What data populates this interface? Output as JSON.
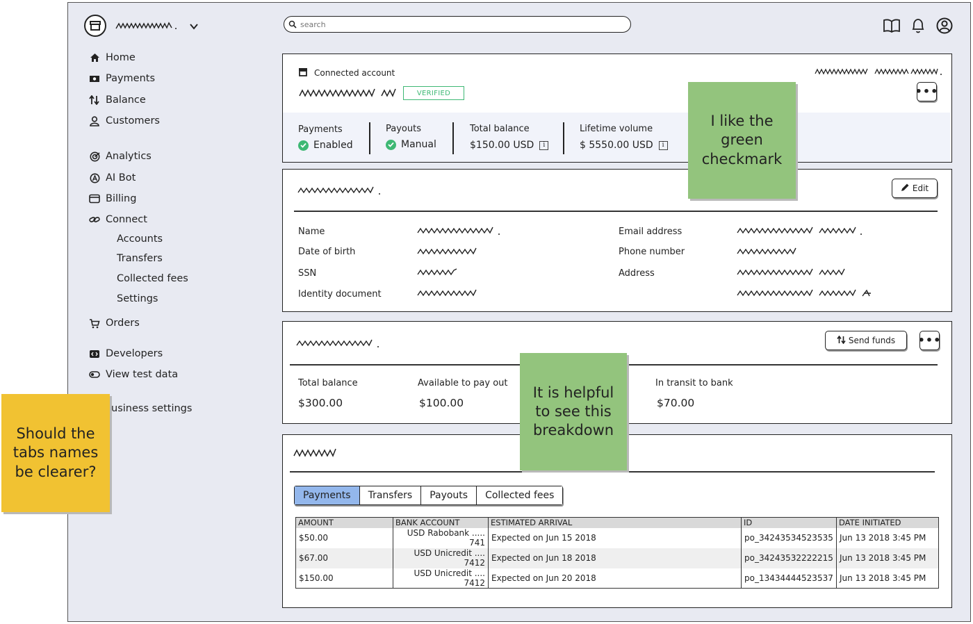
{
  "header": {
    "search_placeholder": "search",
    "icons": [
      "book-icon",
      "bell-icon",
      "user-circle-icon"
    ]
  },
  "sidebar": {
    "items": [
      {
        "label": "Home",
        "icon": "home-icon"
      },
      {
        "label": "Payments",
        "icon": "money-icon"
      },
      {
        "label": "Balance",
        "icon": "arrows-updown-icon"
      },
      {
        "label": "Customers",
        "icon": "person-icon"
      },
      {
        "label": "Analytics",
        "icon": "chart-circle-icon"
      },
      {
        "label": "AI Bot",
        "icon": "ai-icon"
      },
      {
        "label": "Billing",
        "icon": "window-icon"
      },
      {
        "label": "Connect",
        "icon": "link-icon"
      },
      {
        "label": "Accounts"
      },
      {
        "label": "Transfers"
      },
      {
        "label": "Collected fees"
      },
      {
        "label": "Settings"
      },
      {
        "label": "Orders",
        "icon": "cart-icon"
      },
      {
        "label": "Developers",
        "icon": "code-icon"
      },
      {
        "label": "View test data",
        "icon": "toggle-icon"
      },
      {
        "label": "usiness settings"
      }
    ]
  },
  "account": {
    "connected_label": "Connected account",
    "verified": "VERIFIED",
    "stats": {
      "payments_label": "Payments",
      "payments_value": "Enabled",
      "payouts_label": "Payouts",
      "payouts_value": "Manual",
      "total_balance_label": "Total balance",
      "total_balance_value": "$150.00 USD",
      "lifetime_label": "Lifetime volume",
      "lifetime_value": "$ 5550.00 USD"
    },
    "check_color": "#3eb874"
  },
  "details": {
    "edit_label": "Edit",
    "left_fields": [
      "Name",
      "Date of birth",
      "SSN",
      "Identity document"
    ],
    "right_fields": [
      "Email address",
      "Phone number",
      "Address"
    ]
  },
  "balances": {
    "send_funds_label": "Send funds",
    "total_label": "Total balance",
    "total_value": "$300.00",
    "available_label": "Available to pay out",
    "available_value": "$100.00",
    "transit_label": "In transit to bank",
    "transit_value": "$70.00"
  },
  "activity": {
    "tabs": [
      "Payments",
      "Transfers",
      "Payouts",
      "Collected fees"
    ],
    "active_tab": "Payments",
    "active_color": "#93b7ec",
    "columns": [
      "AMOUNT",
      "BANK ACCOUNT",
      "ESTIMATED ARRIVAL",
      "ID",
      "DATE INITIATED"
    ],
    "rows": [
      [
        "$50.00",
        "USD Rabobank ..... 741",
        "Expected on Jun 15 2018",
        "po_34243534523535",
        "Jun 13 2018 3:45 PM"
      ],
      [
        "$67.00",
        "USD Unicredit .... 7412",
        "Expected on Jun 18 2018",
        "po_34243532222215",
        "Jun 13 2018 3:45 PM"
      ],
      [
        "$150.00",
        "USD Unicredit .... 7412",
        "Expected on Jun 20 2018",
        "po_13434444523537",
        "Jun 13 2018 3:45 PM"
      ]
    ]
  },
  "notes": {
    "green_top": "I like the green checkmark",
    "green_mid": "It is helpful to see this breakdown",
    "yellow": "Should the tabs names be clearer?",
    "green_color": "#93c47d",
    "yellow_color": "#f1c232"
  }
}
